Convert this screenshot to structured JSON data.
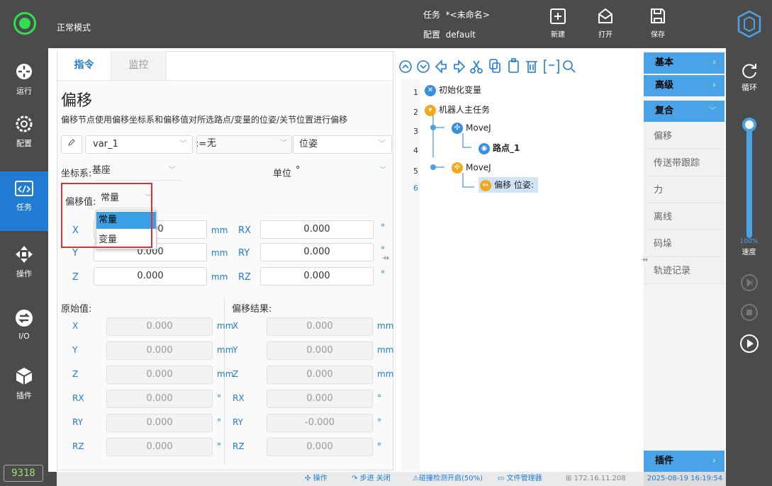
{
  "topbar": {
    "mode": "正常模式",
    "task_label": "任务",
    "task_name": "*<未命名>",
    "config_label": "配置",
    "config_name": "default",
    "new_label": "新建",
    "open_label": "打开",
    "save_label": "保存"
  },
  "nav": {
    "run": "运行",
    "config": "配置",
    "task": "任务",
    "operate": "操作",
    "io": "I/O",
    "plugin": "插件",
    "counter": "9318"
  },
  "tabs": {
    "command": "指令",
    "monitor": "监控"
  },
  "node": {
    "title": "偏移",
    "desc": "偏移节点使用偏移坐标系和偏移值对所选路点/变量的位姿/关节位置进行偏移",
    "var": "var_1",
    "assign": ":=",
    "value": "无",
    "type": "位姿",
    "coord_label": "坐标系:",
    "coord_value": "基座",
    "unit_label": "单位",
    "unit_value": "°",
    "offset_label": "偏移值:",
    "offset_value": "常量",
    "options": [
      "常量",
      "变量"
    ]
  },
  "offset": {
    "x": {
      "label": "X",
      "value": "0.000",
      "unit": "mm"
    },
    "y": {
      "label": "Y",
      "value": "0.000",
      "unit": "mm"
    },
    "z": {
      "label": "Z",
      "value": "0.000",
      "unit": "mm"
    },
    "rx": {
      "label": "RX",
      "value": "0.000",
      "unit": "°"
    },
    "ry": {
      "label": "RY",
      "value": "0.000",
      "unit": "°"
    },
    "rz": {
      "label": "RZ",
      "value": "0.000",
      "unit": "°"
    }
  },
  "original": {
    "title": "原始值:",
    "rows": [
      {
        "label": "X",
        "value": "0.000",
        "unit": "mm"
      },
      {
        "label": "Y",
        "value": "0.000",
        "unit": "mm"
      },
      {
        "label": "Z",
        "value": "0.000",
        "unit": "mm"
      },
      {
        "label": "RX",
        "value": "0.000",
        "unit": "°"
      },
      {
        "label": "RY",
        "value": "0.000",
        "unit": "°"
      },
      {
        "label": "RZ",
        "value": "0.000",
        "unit": "°"
      }
    ]
  },
  "result": {
    "title": "偏移结果:",
    "rows": [
      {
        "label": "X",
        "value": "0.000",
        "unit": "mm"
      },
      {
        "label": "Y",
        "value": "0.000",
        "unit": "mm"
      },
      {
        "label": "Z",
        "value": "0.000",
        "unit": "mm"
      },
      {
        "label": "RX",
        "value": "0.000",
        "unit": "°"
      },
      {
        "label": "RY",
        "value": "-0.000",
        "unit": "°"
      },
      {
        "label": "RZ",
        "value": "0.000",
        "unit": "°"
      }
    ]
  },
  "tree": {
    "lines": [
      "1",
      "2",
      "3",
      "4",
      "5",
      "6"
    ],
    "n1": "初始化变量",
    "n2": "机器人主任务",
    "n3": "MoveJ",
    "n4": "路点_1",
    "n5": "MoveJ",
    "n6": "偏移 位姿:"
  },
  "categories": {
    "basic": "基本",
    "advanced": "高级",
    "compound": "复合",
    "items": [
      "偏移",
      "传送带跟踪",
      "力",
      "离线",
      "码垛",
      "轨迹记录"
    ],
    "plugin": "插件"
  },
  "rightbar": {
    "loop": "循环",
    "speed_pct": "100%",
    "speed_label": "速度",
    "speed_level": 1.0
  },
  "statusbar": {
    "operate": "操作",
    "step": "步进 关闭",
    "collision": "碰撞检测开启(50%)",
    "files": "文件管理器",
    "ip": "172.16.11.208",
    "time": "2025-08-19 16:19:54"
  },
  "colors": {
    "accent": "#1f7bd3",
    "status_green": "#2ee04b",
    "highlight_box": "#e03030"
  }
}
